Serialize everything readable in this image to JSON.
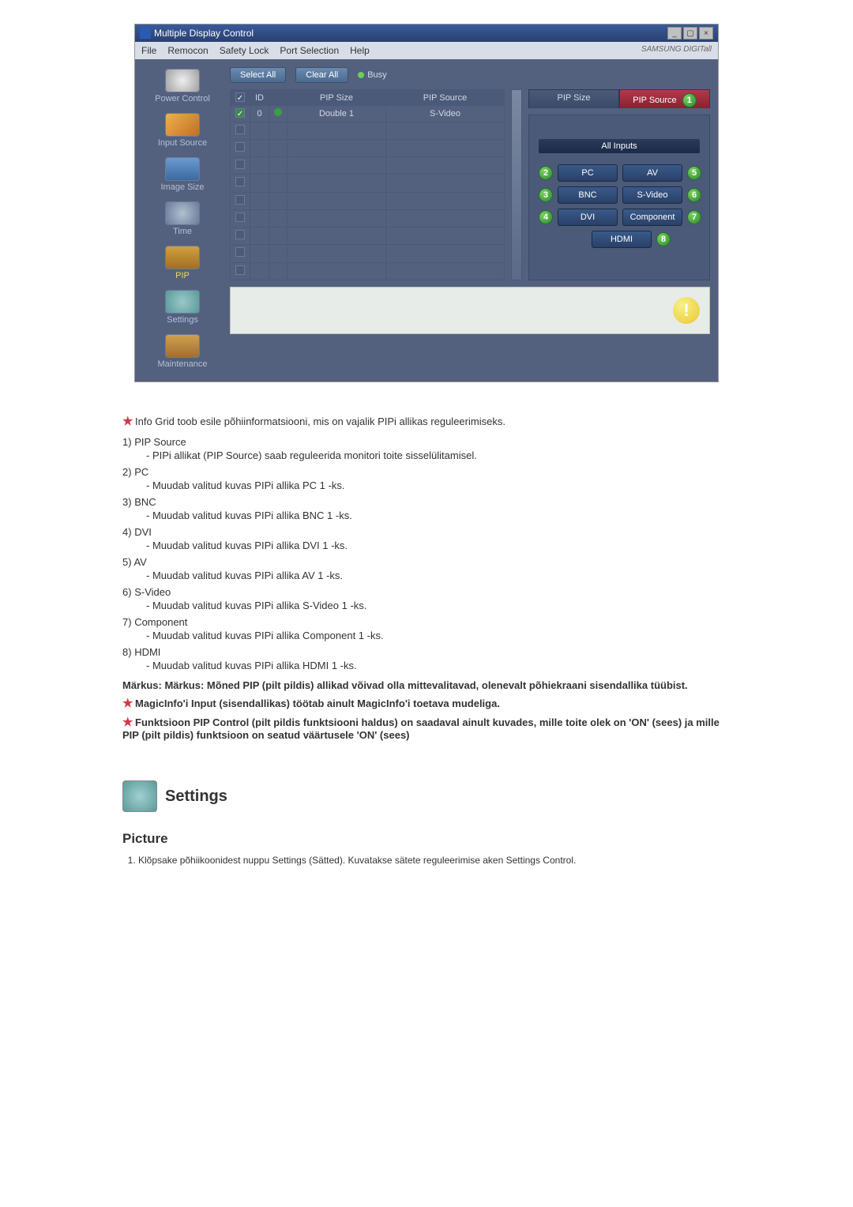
{
  "window": {
    "title": "Multiple Display Control",
    "menu": [
      "File",
      "Remocon",
      "Safety Lock",
      "Port Selection",
      "Help"
    ],
    "brand": "SAMSUNG DIGITall"
  },
  "sidebar": [
    {
      "label": "Power Control"
    },
    {
      "label": "Input Source"
    },
    {
      "label": "Image Size"
    },
    {
      "label": "Time"
    },
    {
      "label": "PIP"
    },
    {
      "label": "Settings"
    },
    {
      "label": "Maintenance"
    }
  ],
  "topbar": {
    "select_all": "Select All",
    "clear_all": "Clear All",
    "busy": "Busy"
  },
  "table": {
    "headers": [
      "",
      "ID",
      "",
      "PIP Size",
      "PIP Source"
    ],
    "first_row": {
      "id": "0",
      "size": "Double 1",
      "source": "S-Video"
    }
  },
  "right": {
    "tab_size": "PIP Size",
    "tab_source": "PIP Source",
    "tab_marker": "1",
    "all_inputs": "All Inputs",
    "buttons": [
      {
        "num": "2",
        "label": "PC"
      },
      {
        "num": "5",
        "label": "AV"
      },
      {
        "num": "3",
        "label": "BNC"
      },
      {
        "num": "6",
        "label": "S-Video"
      },
      {
        "num": "4",
        "label": "DVI"
      },
      {
        "num": "7",
        "label": "Component"
      }
    ],
    "hdmi": {
      "num": "8",
      "label": "HDMI"
    }
  },
  "doc": {
    "intro": "Info Grid toob esile põhiinformatsiooni, mis on vajalik PIPi allikas reguleerimiseks.",
    "items": [
      {
        "n": "1)",
        "t": "PIP Source",
        "d": "- PIPi allikat (PIP Source) saab reguleerida monitori toite sisselülitamisel."
      },
      {
        "n": "2)",
        "t": "PC",
        "d": "- Muudab valitud kuvas PIPi allika PC 1 -ks."
      },
      {
        "n": "3)",
        "t": "BNC",
        "d": "- Muudab valitud kuvas PIPi allika BNC 1 -ks."
      },
      {
        "n": "4)",
        "t": "DVI",
        "d": "- Muudab valitud kuvas PIPi allika DVI 1 -ks."
      },
      {
        "n": "5)",
        "t": "AV",
        "d": "- Muudab valitud kuvas PIPi allika AV 1 -ks."
      },
      {
        "n": "6)",
        "t": "S-Video",
        "d": "- Muudab valitud kuvas PIPi allika S-Video 1 -ks."
      },
      {
        "n": "7)",
        "t": "Component",
        "d": "- Muudab valitud kuvas PIPi allika Component 1 -ks."
      },
      {
        "n": "8)",
        "t": "HDMI",
        "d": "- Muudab valitud kuvas PIPi allika HDMI 1 -ks."
      }
    ],
    "markus": "Märkus: Märkus: Mõned PIP (pilt pildis) allikad võivad olla mittevalitavad, olenevalt põhiekraani sisendallika tüübist.",
    "star1": "MagicInfo'i Input (sisendallikas) töötab ainult MagicInfo'i toetava mudeliga.",
    "star2": "Funktsioon PIP Control (pilt pildis funktsiooni haldus) on saadaval ainult kuvades, mille toite olek on 'ON' (sees) ja mille PIP (pilt pildis) funktsioon on seatud väärtusele 'ON' (sees)",
    "settings_h": "Settings",
    "picture_h": "Picture",
    "picture_step1": "Klõpsake põhiikoonidest nuppu Settings (Sätted). Kuvatakse sätete reguleerimise aken Settings Control."
  }
}
